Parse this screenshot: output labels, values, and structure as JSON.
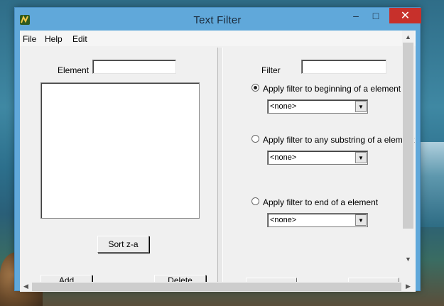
{
  "window": {
    "title": "Text Filter"
  },
  "menu": [
    "File",
    "Help",
    "Edit"
  ],
  "left": {
    "element_label": "Element",
    "element_value": "",
    "sort_button": "Sort z-a",
    "add_button": "Add",
    "delete_button": "Delete"
  },
  "right": {
    "filter_label": "Filter",
    "filter_value": "",
    "options": [
      {
        "label": "Apply filter to beginning of a element",
        "checked": true,
        "dropdown": "<none>"
      },
      {
        "label": "Apply filter to any substring of a element",
        "checked": false,
        "dropdown": "<none>"
      },
      {
        "label": "Apply filter to end of a element",
        "checked": false,
        "dropdown": "<none>"
      }
    ]
  },
  "icons": {
    "close": "close-icon",
    "minimize": "minimize-icon",
    "maximize": "maximize-icon",
    "app": "app-icon"
  },
  "colors": {
    "titlebar": "#60a8da",
    "close_button": "#c7302b"
  }
}
